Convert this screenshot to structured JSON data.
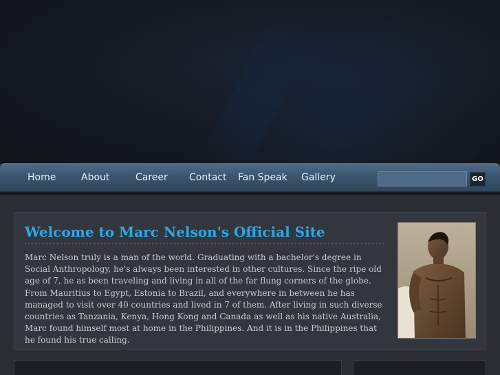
{
  "nav": {
    "items": [
      {
        "label": "Home"
      },
      {
        "label": "About"
      },
      {
        "label": "Career"
      },
      {
        "label": "Contact"
      },
      {
        "label": "Fan Speak"
      },
      {
        "label": "Gallery"
      }
    ]
  },
  "search": {
    "placeholder": "",
    "button_label": "GO"
  },
  "welcome": {
    "title": "Welcome to Marc Nelson's Official Site",
    "body": "Marc Nelson truly is a man of the world. Graduating with a bachelor's degree in Social Anthropology, he's always been interested in other cultures. Since the ripe old age of 7, he as been traveling and living in all of the far flung corners of the globe. From Mauritius to Egypt, Estonia to Brazil, and everywhere in between he has managed to visit over 40 countries and lived in 7 of them. After living in such diverse countries as Tanzania, Kenya, Hong Kong and Canada as well as his native Australia, Marc found himself most at home in the Philippines. And it is in the Philippines that he found his true calling."
  },
  "colors": {
    "accent": "#2ea6e8",
    "nav_bar": "#3d566f",
    "panel": "#33373d",
    "page_bg": "#2a2e33"
  }
}
